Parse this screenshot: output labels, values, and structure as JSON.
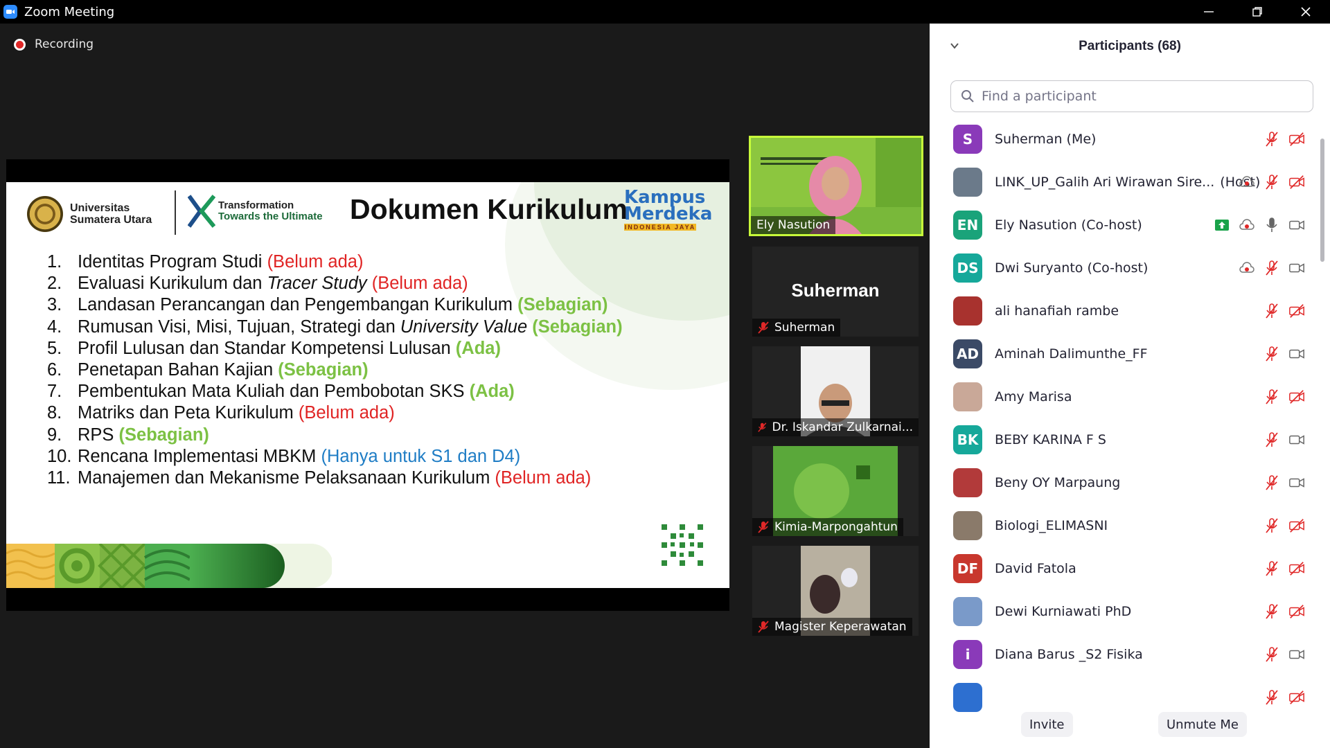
{
  "window": {
    "title": "Zoom Meeting"
  },
  "recording": {
    "label": "Recording"
  },
  "slide": {
    "university_line1": "Universitas",
    "university_line2": "Sumatera Utara",
    "tagline_line1": "Transformation",
    "tagline_line2": "Towards the Ultimate",
    "title": "Dokumen Kurikulum",
    "km_line1": "Kampus",
    "km_line2": "Merdeka",
    "km_line3": "INDONESIA JAYA",
    "items": [
      {
        "num": "1.",
        "text": "Identitas Program Studi ",
        "italic": "",
        "rest": "",
        "status": "(Belum ada)",
        "color": "red"
      },
      {
        "num": "2.",
        "text": "Evaluasi Kurikulum dan ",
        "italic": "Tracer Study",
        "rest": " ",
        "status": "(Belum ada)",
        "color": "red"
      },
      {
        "num": "3.",
        "text": "Landasan Perancangan dan Pengembangan Kurikulum ",
        "italic": "",
        "rest": "",
        "status": "(Sebagian)",
        "color": "green"
      },
      {
        "num": "4.",
        "text": "Rumusan Visi, Misi, Tujuan, Strategi dan ",
        "italic": "University Value",
        "rest": " ",
        "status": "(Sebagian)",
        "color": "green"
      },
      {
        "num": "5.",
        "text": "Profil Lulusan dan Standar Kompetensi Lulusan ",
        "italic": "",
        "rest": "",
        "status": "(Ada)",
        "color": "green"
      },
      {
        "num": "6.",
        "text": "Penetapan Bahan Kajian ",
        "italic": "",
        "rest": "",
        "status": "(Sebagian)",
        "color": "green"
      },
      {
        "num": "7.",
        "text": "Pembentukan Mata Kuliah dan Pembobotan SKS ",
        "italic": "",
        "rest": "",
        "status": "(Ada)",
        "color": "green"
      },
      {
        "num": "8.",
        "text": "Matriks dan Peta Kurikulum ",
        "italic": "",
        "rest": "",
        "status": "(Belum ada)",
        "color": "red"
      },
      {
        "num": "9.",
        "text": "RPS ",
        "italic": "",
        "rest": "",
        "status": "(Sebagian)",
        "color": "green"
      },
      {
        "num": "10.",
        "text": "Rencana Implementasi MBKM ",
        "italic": "",
        "rest": "",
        "status": "(Hanya untuk S1 dan D4)",
        "color": "blue"
      },
      {
        "num": "11.",
        "text": "Manajemen dan Mekanisme Pelaksanaan Kurikulum  ",
        "italic": "",
        "rest": "",
        "status": "(Belum ada)",
        "color": "red"
      }
    ]
  },
  "gallery": [
    {
      "name": "Ely Nasution",
      "muted": false,
      "active": true
    },
    {
      "name": "Suherman",
      "display_name": "Suherman",
      "muted": true
    },
    {
      "name": "Dr. Iskandar Zulkarnai...",
      "muted": true
    },
    {
      "name": "Kimia-Marpongahtun",
      "muted": true
    },
    {
      "name": "Magister Keperawatan",
      "muted": true
    }
  ],
  "participants_panel": {
    "title": "Participants (68)",
    "search_placeholder": "Find a participant",
    "participants": [
      {
        "name": "Suherman (Me)",
        "initials": "S",
        "avatar_color": "#8a3ab9",
        "mic": "muted",
        "video": "off",
        "recording": false,
        "share": false
      },
      {
        "name": "LINK_UP_Galih Ari Wirawan Sire...",
        "role": "(Host)",
        "initials": "",
        "avatar_color": "#6b7a8a",
        "mic": "muted",
        "video": "off",
        "recording": true,
        "share": false
      },
      {
        "name": "Ely Nasution (Co-host)",
        "initials": "EN",
        "avatar_color": "#1aa37a",
        "mic": "on",
        "video": "on",
        "recording": true,
        "share": true
      },
      {
        "name": "Dwi Suryanto (Co-host)",
        "initials": "DS",
        "avatar_color": "#16a89a",
        "mic": "muted",
        "video": "on",
        "recording": true,
        "share": false
      },
      {
        "name": "ali hanafiah rambe",
        "initials": "",
        "avatar_color": "#a8322e",
        "mic": "muted",
        "video": "off",
        "recording": false,
        "share": false
      },
      {
        "name": "Aminah Dalimunthe_FF",
        "initials": "AD",
        "avatar_color": "#3b4a66",
        "mic": "muted",
        "video": "on",
        "recording": false,
        "share": false
      },
      {
        "name": "Amy Marisa",
        "initials": "",
        "avatar_color": "#c9a898",
        "mic": "muted",
        "video": "off",
        "recording": false,
        "share": false
      },
      {
        "name": "BEBY KARINA F S",
        "initials": "BK",
        "avatar_color": "#16a89a",
        "mic": "muted",
        "video": "on",
        "recording": false,
        "share": false
      },
      {
        "name": "Beny OY Marpaung",
        "initials": "",
        "avatar_color": "#b23a3a",
        "mic": "muted",
        "video": "on",
        "recording": false,
        "share": false
      },
      {
        "name": "Biologi_ELIMASNI",
        "initials": "",
        "avatar_color": "#8a7a6a",
        "mic": "muted",
        "video": "off",
        "recording": false,
        "share": false
      },
      {
        "name": "David Fatola",
        "initials": "DF",
        "avatar_color": "#c8372d",
        "mic": "muted",
        "video": "off",
        "recording": false,
        "share": false
      },
      {
        "name": "Dewi Kurniawati PhD",
        "initials": "",
        "avatar_color": "#7a9ac9",
        "mic": "muted",
        "video": "off",
        "recording": false,
        "share": false
      },
      {
        "name": "Diana Barus _S2 Fisika",
        "initials": "i",
        "avatar_color": "#8a3ab9",
        "mic": "muted",
        "video": "on",
        "recording": false,
        "share": false
      },
      {
        "name": "",
        "initials": "",
        "avatar_color": "#2d6fd0",
        "mic": "muted",
        "video": "off",
        "recording": false,
        "share": false
      }
    ],
    "invite_label": "Invite",
    "unmute_label": "Unmute Me"
  }
}
